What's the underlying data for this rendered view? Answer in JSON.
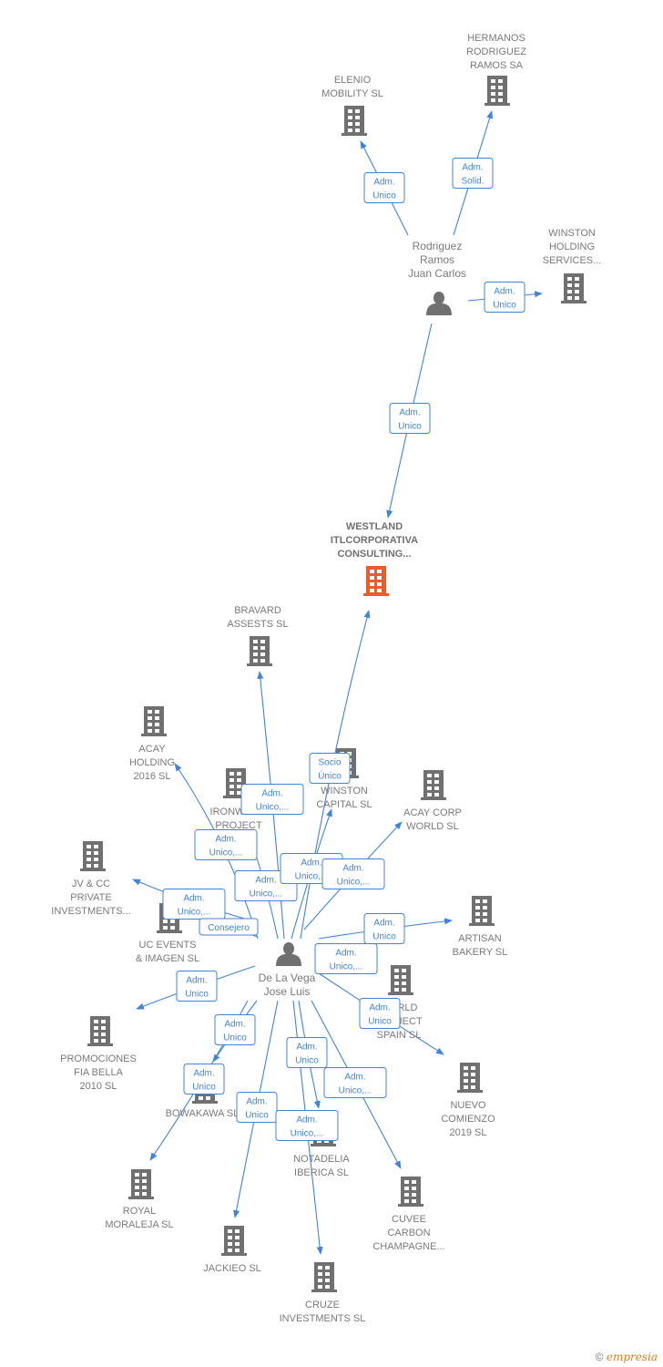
{
  "colors": {
    "edge": "#3f84dc",
    "node": "#707070",
    "focus": "#f05a28",
    "label": "#7a7a7a"
  },
  "nodes": [
    {
      "id": "hermanos",
      "type": "company",
      "label": [
        "HERMANOS",
        "RODRIGUEZ",
        "RAMOS SA"
      ]
    },
    {
      "id": "elenio",
      "type": "company",
      "label": [
        "ELENIO",
        "MOBILITY  SL"
      ]
    },
    {
      "id": "winston_holding",
      "type": "company",
      "label": [
        "WINSTON",
        "HOLDING",
        "SERVICES..."
      ]
    },
    {
      "id": "rodriguez",
      "type": "person",
      "label": [
        "Rodriguez",
        "Ramos",
        "Juan Carlos"
      ]
    },
    {
      "id": "westland",
      "type": "focus",
      "label": [
        "WESTLAND",
        "ITLCORPORATIVA",
        "CONSULTING..."
      ]
    },
    {
      "id": "bravard",
      "type": "company",
      "label": [
        "BRAVARD",
        "ASSESTS  SL"
      ]
    },
    {
      "id": "acay_holding",
      "type": "company",
      "label": [
        "ACAY",
        "HOLDING",
        "2016  SL"
      ]
    },
    {
      "id": "ironwood",
      "type": "company",
      "label": [
        "IRONWOOD",
        "PROJECT",
        "SL"
      ]
    },
    {
      "id": "winston_capital",
      "type": "company",
      "label": [
        "WINSTON",
        "CAPITAL  SL"
      ]
    },
    {
      "id": "acay_corp",
      "type": "company",
      "label": [
        "ACAY CORP",
        "WORLD  SL"
      ]
    },
    {
      "id": "jvcc",
      "type": "company",
      "label": [
        "JV & CC",
        "PRIVATE",
        "INVESTMENTS..."
      ]
    },
    {
      "id": "uc_events",
      "type": "company",
      "label": [
        "UC EVENTS",
        "& IMAGEN SL"
      ]
    },
    {
      "id": "artisan",
      "type": "company",
      "label": [
        "ARTISAN",
        "BAKERY SL"
      ]
    },
    {
      "id": "world_project",
      "type": "company",
      "label": [
        "WORLD",
        "PROJECT",
        "SPAIN  SL"
      ]
    },
    {
      "id": "promociones",
      "type": "company",
      "label": [
        "PROMOCIONES",
        "FIA BELLA",
        "2010 SL"
      ]
    },
    {
      "id": "nuevo",
      "type": "company",
      "label": [
        "NUEVO",
        "COMIENZO",
        "2019  SL"
      ]
    },
    {
      "id": "bowakawa",
      "type": "company",
      "label": [
        "BOWAKAWA SL"
      ]
    },
    {
      "id": "notadelia",
      "type": "company",
      "label": [
        "NOTADELIA",
        "IBERICA  SL"
      ]
    },
    {
      "id": "royal",
      "type": "company",
      "label": [
        "ROYAL",
        "MORALEJA  SL"
      ]
    },
    {
      "id": "cuvee",
      "type": "company",
      "label": [
        "CUVEE",
        "CARBON",
        "CHAMPAGNE..."
      ]
    },
    {
      "id": "jackieo",
      "type": "company",
      "label": [
        "JACKIEO  SL"
      ]
    },
    {
      "id": "cruze",
      "type": "company",
      "label": [
        "CRUZE",
        "INVESTMENTS SL"
      ]
    },
    {
      "id": "delavega",
      "type": "person",
      "label": [
        "De La Vega",
        "Jose Luis"
      ]
    }
  ],
  "edges": [
    {
      "from": "rodriguez",
      "to": "elenio",
      "label": [
        "Adm.",
        "Unico"
      ]
    },
    {
      "from": "rodriguez",
      "to": "hermanos",
      "label": [
        "Adm.",
        "Solid."
      ]
    },
    {
      "from": "rodriguez",
      "to": "winston_holding",
      "label": [
        "Adm.",
        "Unico"
      ]
    },
    {
      "from": "rodriguez",
      "to": "westland",
      "label": [
        "Adm.",
        "Unico"
      ]
    },
    {
      "from": "delavega",
      "to": "westland",
      "label": [
        "Socio",
        "Único"
      ]
    },
    {
      "from": "delavega",
      "to": "bravard",
      "label": [
        "Adm.",
        "Unico,..."
      ]
    },
    {
      "from": "delavega",
      "to": "acay_holding",
      "label": [
        "Adm.",
        "Unico,..."
      ]
    },
    {
      "from": "delavega",
      "to": "ironwood",
      "label": [
        "Adm.",
        "Unico,..."
      ]
    },
    {
      "from": "delavega",
      "to": "winston_capital",
      "label": [
        "Adm.",
        "Unico,..."
      ]
    },
    {
      "from": "delavega",
      "to": "acay_corp",
      "label": [
        "Adm.",
        "Unico,..."
      ]
    },
    {
      "from": "delavega",
      "to": "jvcc",
      "label": [
        "Adm.",
        "Unico,..."
      ]
    },
    {
      "from": "delavega",
      "to": "uc_events",
      "label": [
        "Consejero"
      ]
    },
    {
      "from": "delavega",
      "to": "artisan",
      "label": [
        "Adm.",
        "Unico"
      ]
    },
    {
      "from": "delavega",
      "to": "world_project",
      "label": [
        "Adm.",
        "Unico,..."
      ]
    },
    {
      "from": "delavega",
      "to": "nuevo",
      "label": [
        "Adm.",
        "Unico"
      ]
    },
    {
      "from": "delavega",
      "to": "promociones",
      "label": [
        "Adm.",
        "Unico"
      ]
    },
    {
      "from": "delavega",
      "to": "bowakawa",
      "label": [
        "Adm.",
        "Unico"
      ]
    },
    {
      "from": "delavega",
      "to": "royal",
      "label": [
        "Adm.",
        "Unico"
      ]
    },
    {
      "from": "delavega",
      "to": "jackieo",
      "label": [
        "Adm.",
        "Unico"
      ]
    },
    {
      "from": "delavega",
      "to": "notadelia",
      "label": [
        "Adm.",
        "Unico"
      ]
    },
    {
      "from": "delavega",
      "to": "cruze",
      "label": [
        "Adm.",
        "Unico,..."
      ]
    },
    {
      "from": "delavega",
      "to": "cuvee",
      "label": [
        "Adm.",
        "Unico,..."
      ]
    }
  ],
  "footer": {
    "copyright": "©",
    "brand": "empresia"
  }
}
